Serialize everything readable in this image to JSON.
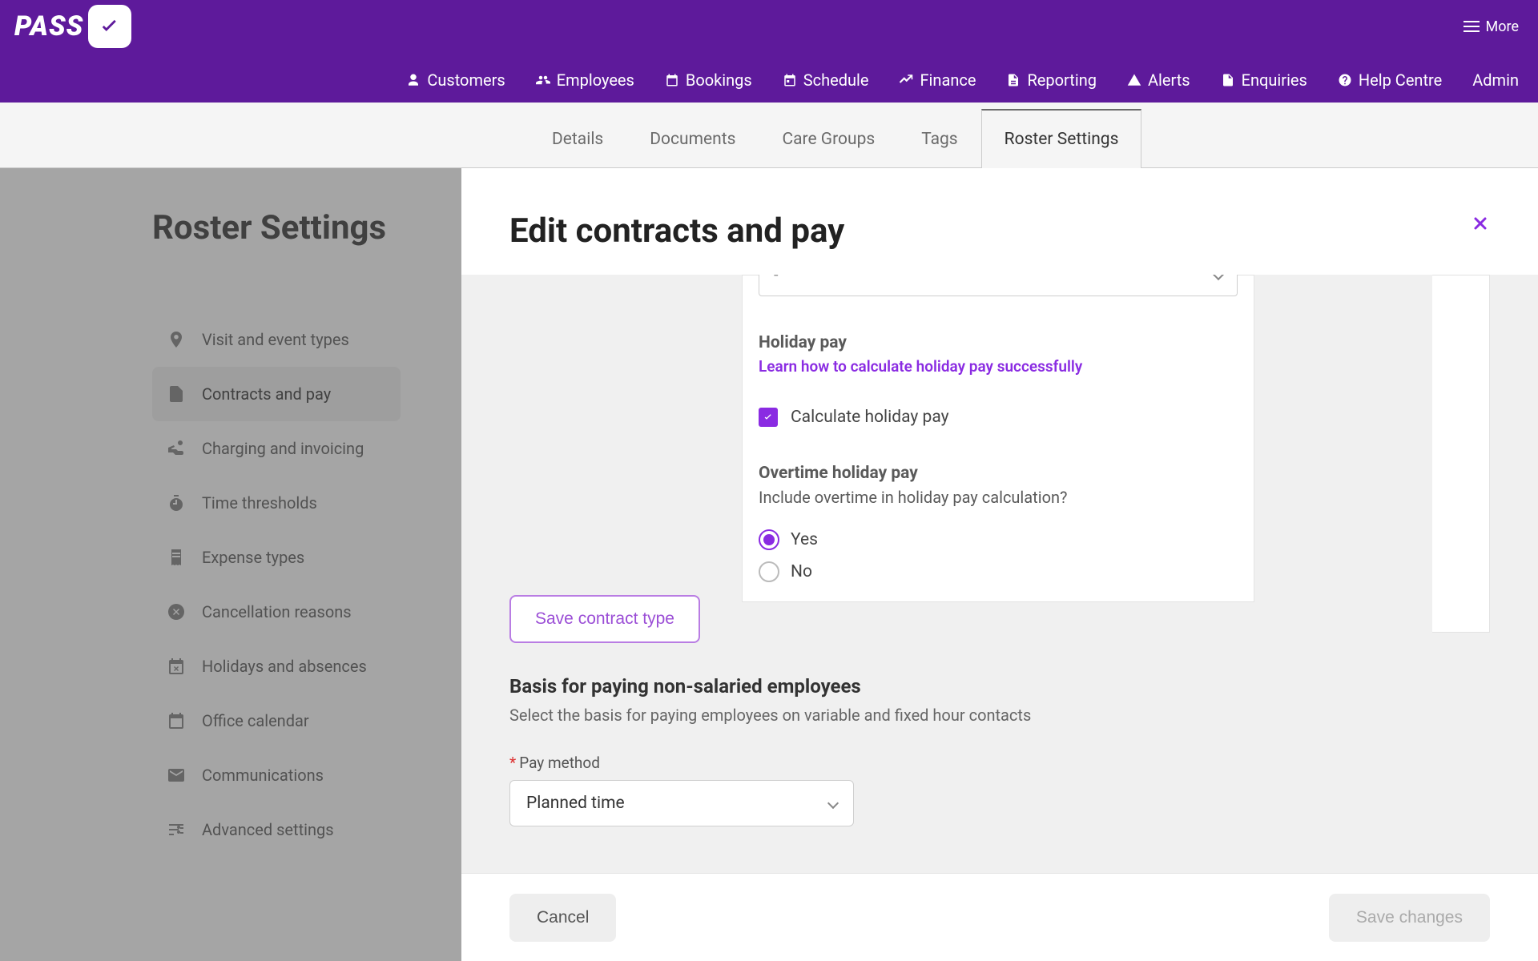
{
  "brand": {
    "name": "PASS"
  },
  "topbar": {
    "more": "More"
  },
  "nav": {
    "customers": "Customers",
    "employees": "Employees",
    "bookings": "Bookings",
    "schedule": "Schedule",
    "finance": "Finance",
    "reporting": "Reporting",
    "alerts": "Alerts",
    "enquiries": "Enquiries",
    "help_centre": "Help Centre",
    "admin": "Admin"
  },
  "tabs": {
    "details": "Details",
    "documents": "Documents",
    "care_groups": "Care Groups",
    "tags": "Tags",
    "roster_settings": "Roster Settings"
  },
  "page": {
    "title": "Roster Settings",
    "sidenav": {
      "visit_event_types": "Visit and event types",
      "contracts_pay": "Contracts and pay",
      "charging_invoicing": "Charging and invoicing",
      "time_thresholds": "Time thresholds",
      "expense_types": "Expense types",
      "cancellation_reasons": "Cancellation reasons",
      "holidays_absences": "Holidays and absences",
      "office_calendar": "Office calendar",
      "communications": "Communications",
      "advanced_settings": "Advanced settings"
    }
  },
  "modal": {
    "title": "Edit contracts and pay",
    "top_select_value": "-",
    "holiday_pay": {
      "heading": "Holiday pay",
      "link": "Learn how to calculate holiday pay successfully",
      "checkbox_label": "Calculate holiday pay"
    },
    "overtime": {
      "heading": "Overtime holiday pay",
      "desc": "Include overtime in holiday pay calculation?",
      "yes": "Yes",
      "no": "No"
    },
    "save_contract_btn": "Save contract type",
    "basis": {
      "title": "Basis for paying non-salaried employees",
      "desc": "Select the basis for paying employees on variable and fixed hour contacts",
      "field_label": "Pay method",
      "select_value": "Planned time"
    },
    "footer": {
      "cancel": "Cancel",
      "save": "Save changes"
    }
  }
}
